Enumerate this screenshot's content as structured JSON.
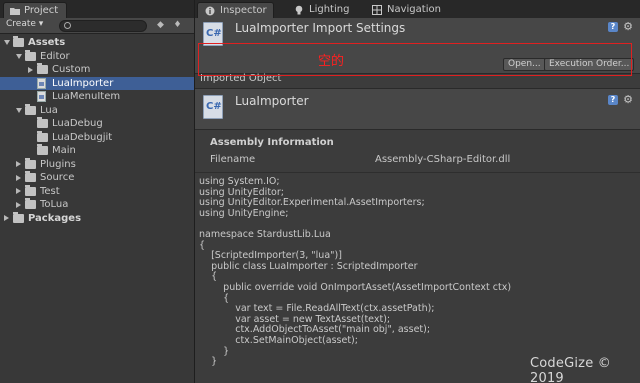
{
  "project": {
    "tab_label": "Project",
    "create_label": "Create ▾",
    "tree": [
      {
        "label": "Assets",
        "depth": 0,
        "arrow": "down",
        "icon": "folder",
        "bold": true
      },
      {
        "label": "Editor",
        "depth": 1,
        "arrow": "down",
        "icon": "folder"
      },
      {
        "label": "Custom",
        "depth": 2,
        "arrow": "right",
        "icon": "folder"
      },
      {
        "label": "LuaImporter",
        "depth": 2,
        "arrow": "",
        "icon": "file",
        "selected": true
      },
      {
        "label": "LuaMenuItem",
        "depth": 2,
        "arrow": "",
        "icon": "file"
      },
      {
        "label": "Lua",
        "depth": 1,
        "arrow": "down",
        "icon": "folder"
      },
      {
        "label": "LuaDebug",
        "depth": 2,
        "arrow": "",
        "icon": "folder"
      },
      {
        "label": "LuaDebugjit",
        "depth": 2,
        "arrow": "",
        "icon": "folder"
      },
      {
        "label": "Main",
        "depth": 2,
        "arrow": "",
        "icon": "folder"
      },
      {
        "label": "Plugins",
        "depth": 1,
        "arrow": "right",
        "icon": "folder"
      },
      {
        "label": "Source",
        "depth": 1,
        "arrow": "right",
        "icon": "folder"
      },
      {
        "label": "Test",
        "depth": 1,
        "arrow": "right",
        "icon": "folder"
      },
      {
        "label": "ToLua",
        "depth": 1,
        "arrow": "right",
        "icon": "folder"
      },
      {
        "label": "Packages",
        "depth": 0,
        "arrow": "right",
        "icon": "folder",
        "bold": true
      }
    ]
  },
  "inspector": {
    "tabs": [
      {
        "label": "Inspector",
        "icon": "info-icon"
      },
      {
        "label": "Lighting",
        "icon": "bulb-icon"
      },
      {
        "label": "Navigation",
        "icon": "navigation-icon"
      }
    ],
    "import_settings_title": "LuaImporter Import Settings",
    "open_label": "Open...",
    "exec_order_label": "Execution Order...",
    "empty_annotation": "空的",
    "imported_object_label": "Imported Object",
    "object_title": "LuaImporter",
    "cs_icon_text": "C#",
    "assembly": {
      "title": "Assembly Information",
      "filename_key": "Filename",
      "filename_value": "Assembly-CSharp-Editor.dll"
    },
    "code_lines": [
      "using System.IO;",
      "using UnityEditor;",
      "using UnityEditor.Experimental.AssetImporters;",
      "using UnityEngine;",
      "",
      "namespace StardustLib.Lua",
      "{",
      "    [ScriptedImporter(3, \"lua\")]",
      "    public class LuaImporter : ScriptedImporter",
      "    {",
      "        public override void OnImportAsset(AssetImportContext ctx)",
      "        {",
      "            var text = File.ReadAllText(ctx.assetPath);",
      "            var asset = new TextAsset(text);",
      "            ctx.AddObjectToAsset(\"main obj\", asset);",
      "            ctx.SetMainObject(asset);",
      "        }",
      "    }"
    ]
  },
  "watermark": "CodeGize © 2019",
  "colors": {
    "selection": "#3e5f96",
    "annotation_red": "#ff2020"
  }
}
